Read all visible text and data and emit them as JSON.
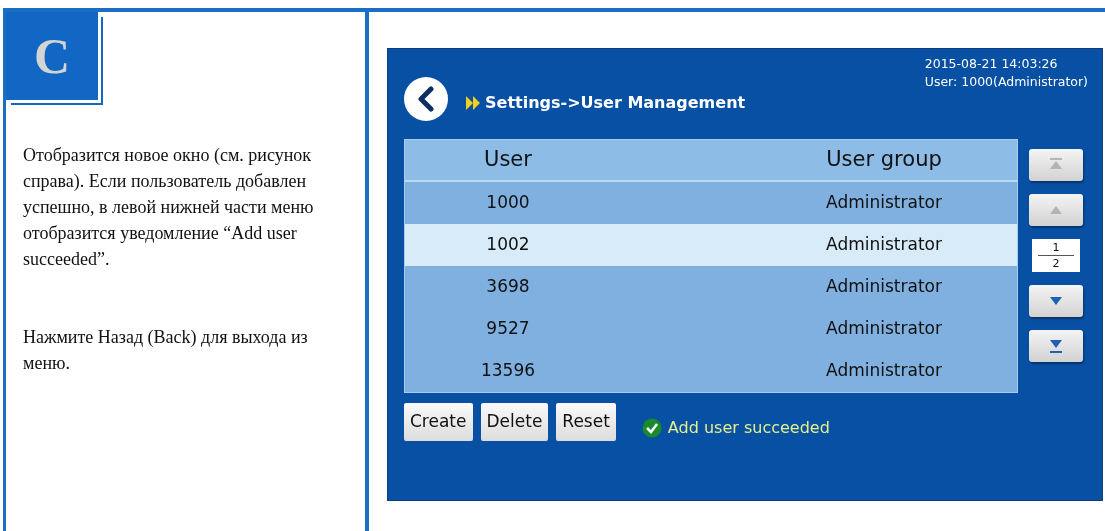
{
  "step": {
    "letter": "C"
  },
  "paragraphs": [
    "Отобразится новое окно (см. рисунок справа). Если пользователь добавлен успешно, в левой нижней части меню отобразится уведомление “Add user succeeded”.",
    "Нажмите Назад (Back) для выхода из меню."
  ],
  "device_screen": {
    "breadcrumb": "Settings->User Management",
    "datetime": "2015-08-21  14:03:26",
    "user": "User: 1000(Administrator)",
    "table": {
      "columns": [
        "User",
        "User group"
      ],
      "rows": [
        {
          "cells": [
            "1000",
            "Administrator"
          ],
          "selected": false
        },
        {
          "cells": [
            "1002",
            "Administrator"
          ],
          "selected": true
        },
        {
          "cells": [
            "3698",
            "Administrator"
          ],
          "selected": false
        },
        {
          "cells": [
            "9527",
            "Administrator"
          ],
          "selected": false
        },
        {
          "cells": [
            "13596",
            "Administrator"
          ],
          "selected": false
        }
      ]
    },
    "pager": {
      "current": "1",
      "total": "2",
      "buttons": [
        {
          "kind": "first",
          "disabled": true
        },
        {
          "kind": "up",
          "disabled": true
        },
        {
          "kind": "down",
          "disabled": false
        },
        {
          "kind": "last",
          "disabled": false
        }
      ]
    },
    "buttons": [
      "Create",
      "Delete",
      "Reset"
    ],
    "status": "Add user succeeded"
  }
}
